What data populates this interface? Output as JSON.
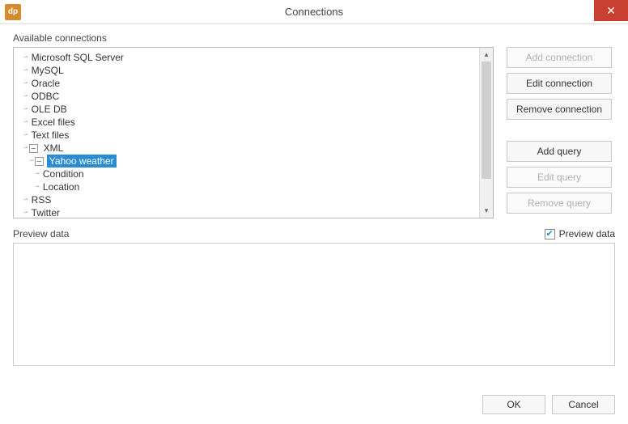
{
  "window": {
    "title": "Connections",
    "icon_text": "dp"
  },
  "sections": {
    "available_label": "Available connections",
    "preview_label": "Preview data"
  },
  "tree": {
    "items": [
      {
        "label": "Microsoft SQL Server",
        "depth": 0,
        "expander": null,
        "selected": false
      },
      {
        "label": "MySQL",
        "depth": 0,
        "expander": null,
        "selected": false
      },
      {
        "label": "Oracle",
        "depth": 0,
        "expander": null,
        "selected": false
      },
      {
        "label": "ODBC",
        "depth": 0,
        "expander": null,
        "selected": false
      },
      {
        "label": "OLE DB",
        "depth": 0,
        "expander": null,
        "selected": false
      },
      {
        "label": "Excel files",
        "depth": 0,
        "expander": null,
        "selected": false
      },
      {
        "label": "Text files",
        "depth": 0,
        "expander": null,
        "selected": false
      },
      {
        "label": "XML",
        "depth": 0,
        "expander": "–",
        "selected": false
      },
      {
        "label": "Yahoo weather",
        "depth": 1,
        "expander": "–",
        "selected": true
      },
      {
        "label": "Condition",
        "depth": 2,
        "expander": null,
        "selected": false
      },
      {
        "label": "Location",
        "depth": 2,
        "expander": null,
        "selected": false
      },
      {
        "label": "RSS",
        "depth": 0,
        "expander": null,
        "selected": false
      },
      {
        "label": "Twitter",
        "depth": 0,
        "expander": null,
        "selected": false
      }
    ]
  },
  "buttons": {
    "add_connection": {
      "label": "Add connection",
      "enabled": false
    },
    "edit_connection": {
      "label": "Edit connection",
      "enabled": true
    },
    "remove_connection": {
      "label": "Remove connection",
      "enabled": true
    },
    "add_query": {
      "label": "Add query",
      "enabled": true
    },
    "edit_query": {
      "label": "Edit query",
      "enabled": false
    },
    "remove_query": {
      "label": "Remove query",
      "enabled": false
    }
  },
  "preview_checkbox": {
    "label": "Preview data",
    "checked": true
  },
  "footer": {
    "ok": "OK",
    "cancel": "Cancel"
  }
}
